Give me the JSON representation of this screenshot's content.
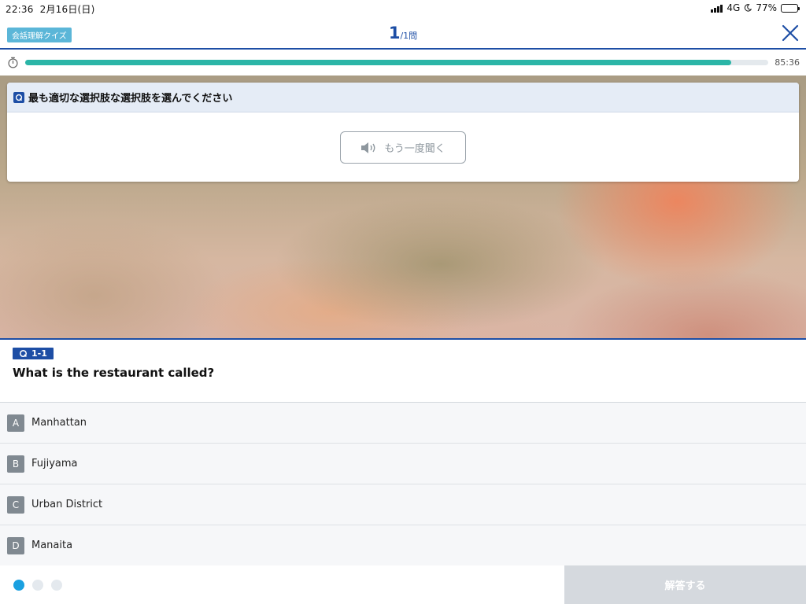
{
  "status_bar": {
    "time": "22:36",
    "date": "2月16日(日)",
    "network": "4G",
    "battery_percent": "77%",
    "battery_level": 0.77,
    "icons": [
      "signal-icon",
      "moon-icon",
      "battery-icon"
    ]
  },
  "header": {
    "quiz_tag": "会話理解クイズ",
    "current": "1",
    "total": "/1問",
    "close_icon": "close-icon"
  },
  "timer": {
    "remaining": "85:36",
    "progress": 0.95,
    "icon": "stopwatch-icon"
  },
  "instruction": {
    "text": "最も適切な選択肢な選択肢を選んでください",
    "listen_again_label": "もう一度聞く",
    "icon": "speaker-icon"
  },
  "question": {
    "badge": "1-1",
    "text": "What is the restaurant called?"
  },
  "answers": [
    {
      "letter": "A",
      "label": "Manhattan"
    },
    {
      "letter": "B",
      "label": "Fujiyama"
    },
    {
      "letter": "C",
      "label": "Urban District"
    },
    {
      "letter": "D",
      "label": "Manaita"
    }
  ],
  "footer": {
    "pages": 3,
    "active_page": 1,
    "submit_label": "解答する"
  },
  "colors": {
    "brand": "#1d4ea5",
    "progress": "#2bb5a7",
    "tag": "#5bb6d8",
    "active_dot": "#1aa0e0",
    "submit_disabled": "#d5d9de"
  }
}
